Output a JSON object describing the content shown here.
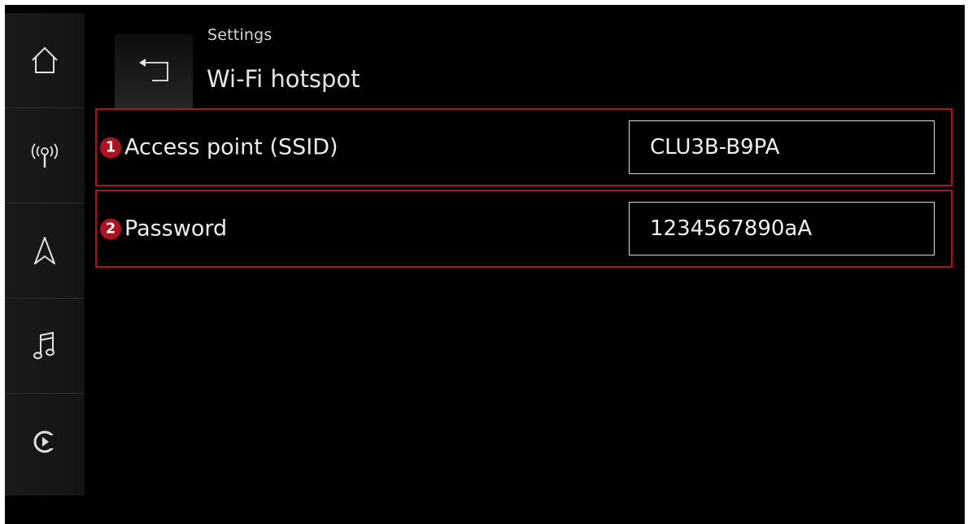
{
  "header": {
    "breadcrumb": "Settings",
    "title": "Wi-Fi hotspot"
  },
  "sidebar": {
    "items": [
      {
        "name": "home",
        "icon": "home-icon"
      },
      {
        "name": "connectivity",
        "icon": "antenna-icon"
      },
      {
        "name": "navigation",
        "icon": "navigation-arrow-icon"
      },
      {
        "name": "media",
        "icon": "music-note-icon"
      },
      {
        "name": "carplay",
        "icon": "play-circle-icon"
      }
    ]
  },
  "settings": [
    {
      "number": "1",
      "label": "Access point (SSID)",
      "value": "CLU3B-B9PA"
    },
    {
      "number": "2",
      "label": "Password",
      "value": "1234567890aA"
    }
  ],
  "colors": {
    "highlight": "#b0121c",
    "background": "#000000",
    "text": "#ececec"
  }
}
